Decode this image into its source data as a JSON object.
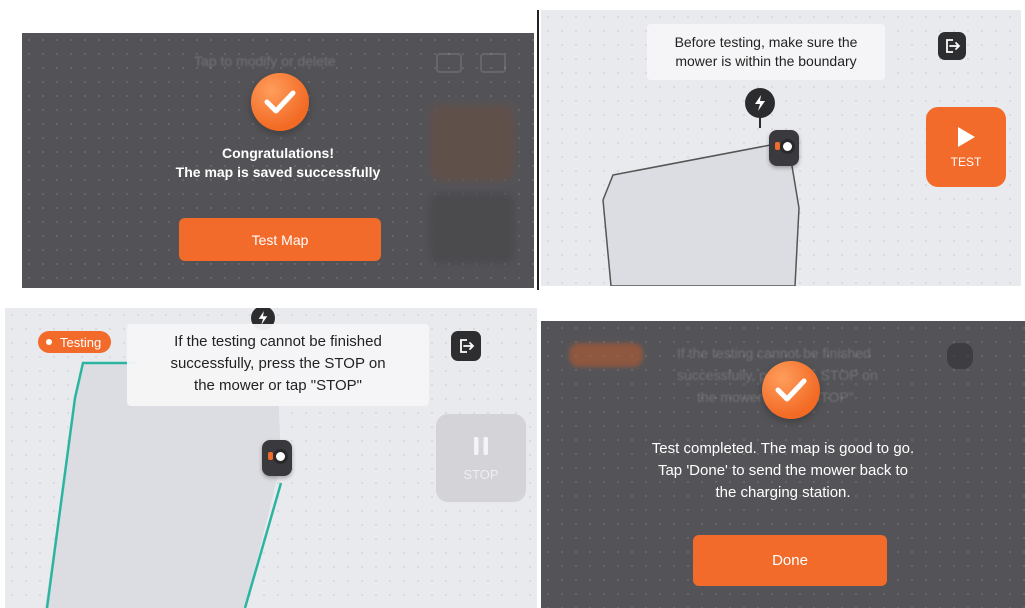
{
  "panel_save": {
    "ghost_hint": "Tap to modify or delete",
    "title": "Congratulations!",
    "message": "The map is saved successfully",
    "button_label": "Test Map",
    "icon": "check-circle-icon"
  },
  "panel_before_test": {
    "tip_line1": "Before testing, make sure the",
    "tip_line2": "mower is within the boundary",
    "test_label": "TEST",
    "icons": [
      "exit-icon",
      "bolt-icon",
      "play-icon",
      "mower-icon"
    ]
  },
  "panel_testing": {
    "status": "Testing",
    "tip_line1": "If the testing cannot be finished",
    "tip_line2": "successfully, press the STOP on",
    "tip_line3": "the mower or tap \"STOP\"",
    "stop_label": "STOP",
    "icons": [
      "exit-icon",
      "bolt-icon",
      "pause-icon",
      "mower-icon"
    ]
  },
  "panel_done": {
    "line1": "Test completed. The map is good to go.",
    "line2": "Tap 'Done' to send the mower back to",
    "line3": "the charging station.",
    "button_label": "Done",
    "ghost_line1": "If the testing cannot be finished",
    "ghost_line2": "successfully, press the STOP on",
    "ghost_line3": "the mower or tap \"STOP\"",
    "icon": "check-circle-icon"
  },
  "colors": {
    "accent": "#f26b2a",
    "boundary_path": "#2bb5a0",
    "map_background": "#e9eaee",
    "overlay": "#4e4e52"
  }
}
